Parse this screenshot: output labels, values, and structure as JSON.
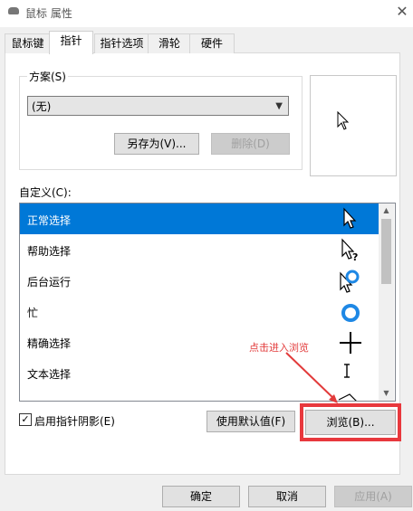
{
  "window": {
    "title": "鼠标 属性"
  },
  "tabs": [
    {
      "label": "鼠标键"
    },
    {
      "label": "指针"
    },
    {
      "label": "指针选项"
    },
    {
      "label": "滑轮"
    },
    {
      "label": "硬件"
    }
  ],
  "scheme": {
    "legend": "方案(S)",
    "selected": "(无)",
    "save_as": "另存为(V)...",
    "delete": "删除(D)"
  },
  "custom": {
    "label": "自定义(C):",
    "items": [
      {
        "label": "正常选择",
        "icon": "arrow-cursor"
      },
      {
        "label": "帮助选择",
        "icon": "help-cursor"
      },
      {
        "label": "后台运行",
        "icon": "working-in-background-cursor"
      },
      {
        "label": "忙",
        "icon": "busy-cursor"
      },
      {
        "label": "精确选择",
        "icon": "crosshair-cursor"
      },
      {
        "label": "文本选择",
        "icon": "text-ibeam-cursor"
      }
    ]
  },
  "options": {
    "shadow_label": "启用指针阴影(E)",
    "shadow_checked": true,
    "use_default": "使用默认值(F)",
    "browse": "浏览(B)..."
  },
  "annotation": {
    "text": "点击进入浏览",
    "color": "#e23b3b"
  },
  "footer": {
    "ok": "确定",
    "cancel": "取消",
    "apply": "应用(A)"
  },
  "colors": {
    "selection": "#0078d7",
    "highlight_box": "#e8383d"
  }
}
